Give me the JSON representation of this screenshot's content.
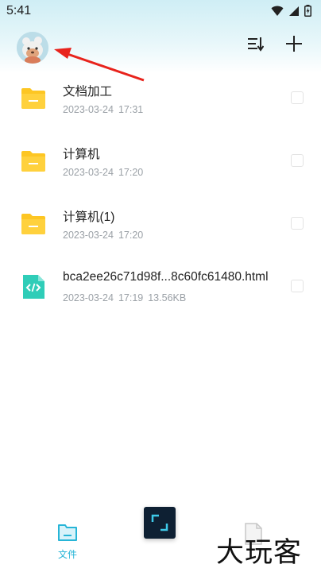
{
  "status_bar": {
    "time": "5:41",
    "icons": [
      "wifi-icon",
      "signal-icon",
      "battery-icon"
    ]
  },
  "header": {
    "avatar": "avatar-bear",
    "sort_icon": "sort-icon",
    "add_icon": "plus-icon"
  },
  "files": [
    {
      "name": "文档加工",
      "date": "2023-03-24",
      "time": "17:31",
      "size": "",
      "type": "folder"
    },
    {
      "name": "计算机",
      "date": "2023-03-24",
      "time": "17:20",
      "size": "",
      "type": "folder"
    },
    {
      "name": "计算机(1)",
      "date": "2023-03-24",
      "time": "17:20",
      "size": "",
      "type": "folder"
    },
    {
      "name": "bca2ee26c71d98f...8c60fc61480.html",
      "date": "2023-03-24",
      "time": "17:19",
      "size": "13.56KB",
      "type": "html"
    }
  ],
  "bottom_nav": {
    "files_label": "文件",
    "watermark": "大玩客"
  },
  "colors": {
    "accent": "#27b5d7",
    "folder": "#fdc623",
    "html_file": "#2fcdb8",
    "annotation": "#e8231c"
  }
}
